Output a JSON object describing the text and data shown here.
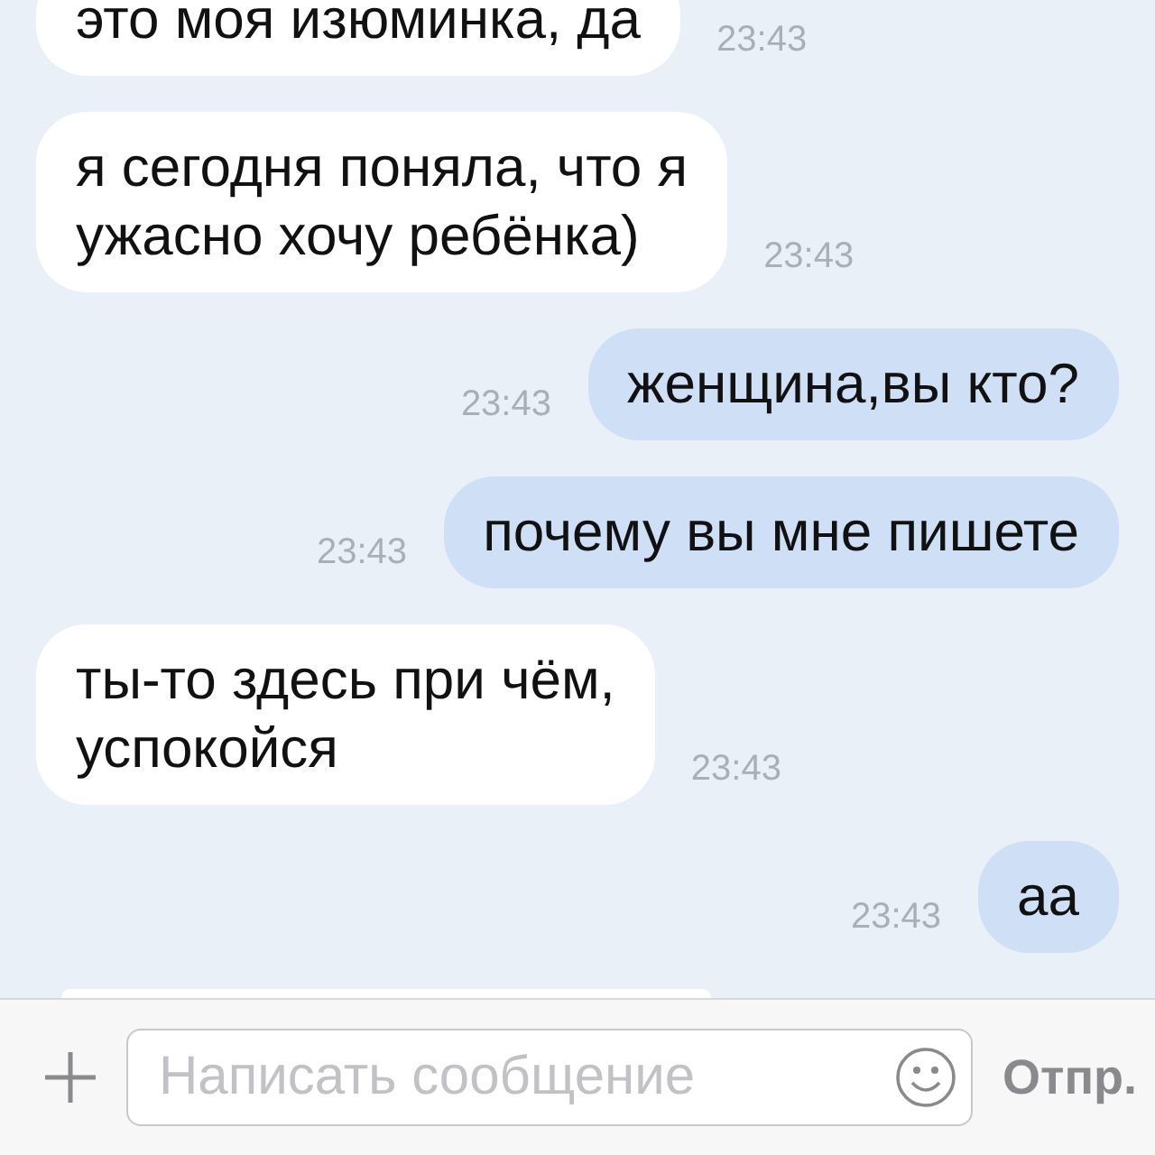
{
  "messages": [
    {
      "kind": "incoming",
      "text": "это моя изюминка, да",
      "time": "23:43"
    },
    {
      "kind": "incoming",
      "text": "я сегодня поняла, что я\nужасно хочу ребёнка)",
      "time": "23:43"
    },
    {
      "kind": "outgoing",
      "text": "женщина,вы кто?",
      "time": "23:43"
    },
    {
      "kind": "outgoing",
      "text": "почему вы мне пишете",
      "time": "23:43"
    },
    {
      "kind": "incoming",
      "text": "ты-то здесь при чём,\nуспокойся",
      "time": "23:43"
    },
    {
      "kind": "outgoing",
      "text": "аа",
      "time": "23:43"
    },
    {
      "kind": "partial"
    }
  ],
  "composer": {
    "placeholder": "Написать сообщение",
    "send": "Отпр."
  }
}
